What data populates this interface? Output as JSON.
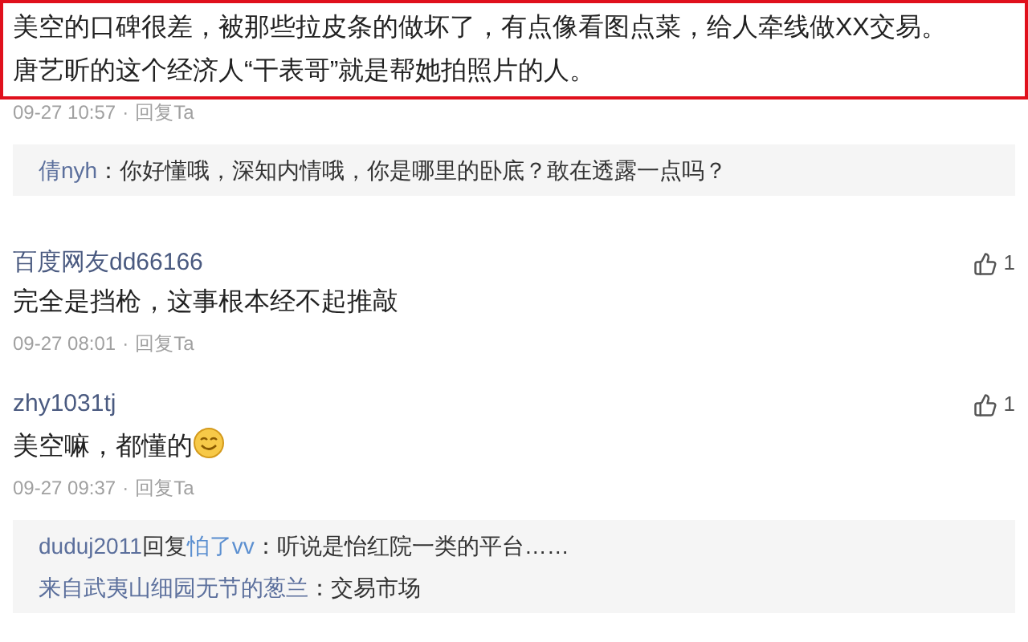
{
  "comments": [
    {
      "kind": "highlighted",
      "lines": [
        "美空的口碑很差，被那些拉皮条的做坏了，有点像看图点菜，给人牵线做XX交易。",
        "唐艺昕的这个经济人“干表哥”就是帮她拍照片的人。"
      ],
      "time": "09-27 10:57",
      "separator": "·",
      "reply_label": "回复Ta",
      "replies": [
        {
          "author": "倩nyh",
          "text": "：你好懂哦，深知内情哦，你是哪里的卧底？敢在透露一点吗？"
        }
      ]
    },
    {
      "kind": "normal",
      "author": "百度网友dd66166",
      "likes": "1",
      "lines": [
        "完全是挡枪，这事根本经不起推敲"
      ],
      "time": "09-27 08:01",
      "separator": "·",
      "reply_label": "回复Ta"
    },
    {
      "kind": "normal",
      "author": "zhy1031tj",
      "likes": "1",
      "lines": [
        "美空嘛，都懂的"
      ],
      "emoji": true,
      "time": "09-27 09:37",
      "separator": "·",
      "reply_label": "回复Ta",
      "replies": [
        {
          "author": "duduj2011",
          "connector": "回复",
          "reply_to": "怕了vv",
          "text": "：听说是怡红院一类的平台……"
        },
        {
          "author": "来自武夷山细园无节的葱兰",
          "text": "：交易市场"
        }
      ]
    }
  ]
}
